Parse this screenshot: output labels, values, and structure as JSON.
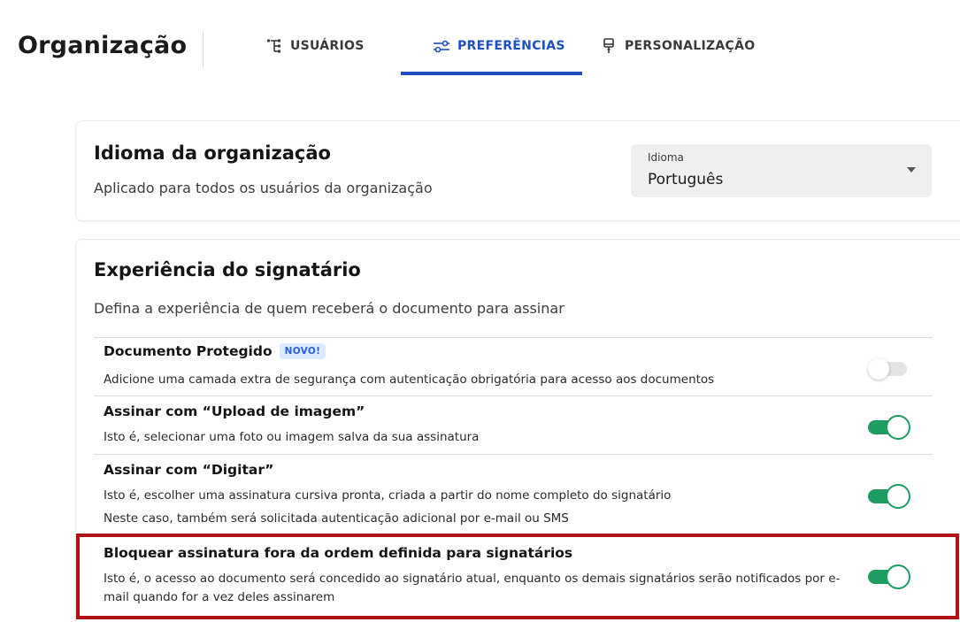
{
  "header": {
    "title": "Organização",
    "tabs": [
      {
        "label": "USUÁRIOS",
        "icon": "users-tree-icon",
        "active": false
      },
      {
        "label": "PREFERÊNCIAS",
        "icon": "sliders-icon",
        "active": true
      },
      {
        "label": "PERSONALIZAÇÃO",
        "icon": "brush-icon",
        "active": false
      }
    ]
  },
  "language_card": {
    "title": "Idioma da organização",
    "subtitle": "Aplicado para todos os usuários da organização",
    "select": {
      "label": "Idioma",
      "value": "Português"
    }
  },
  "signer_card": {
    "title": "Experiência do signatário",
    "subtitle": "Defina a experiência de quem receberá o documento para assinar",
    "options": [
      {
        "title": "Documento Protegido",
        "badge": "NOVO!",
        "description": "Adicione uma camada extra de segurança com autenticação obrigatória para acesso aos documentos",
        "enabled": false
      },
      {
        "title": "Assinar com “Upload de imagem”",
        "description": "Isto é, selecionar uma foto ou imagem salva da sua assinatura",
        "enabled": true
      },
      {
        "title": "Assinar com “Digitar”",
        "description": "Isto é, escolher uma assinatura cursiva pronta, criada a partir do nome completo do signatário",
        "description2": "Neste caso, também será solicitada autenticação adicional por e-mail ou SMS",
        "enabled": true
      },
      {
        "title": "Bloquear assinatura fora da ordem definida para signatários",
        "description": "Isto é, o acesso ao documento será concedido ao signatário atual, enquanto os demais signatários serão notificados por e-mail quando for a vez deles assinarem",
        "enabled": true
      }
    ]
  },
  "colors": {
    "accent": "#1f4fbf",
    "toggle_on": "#1e9d62",
    "badge_bg": "#dceaff",
    "highlight": "#b01116"
  }
}
